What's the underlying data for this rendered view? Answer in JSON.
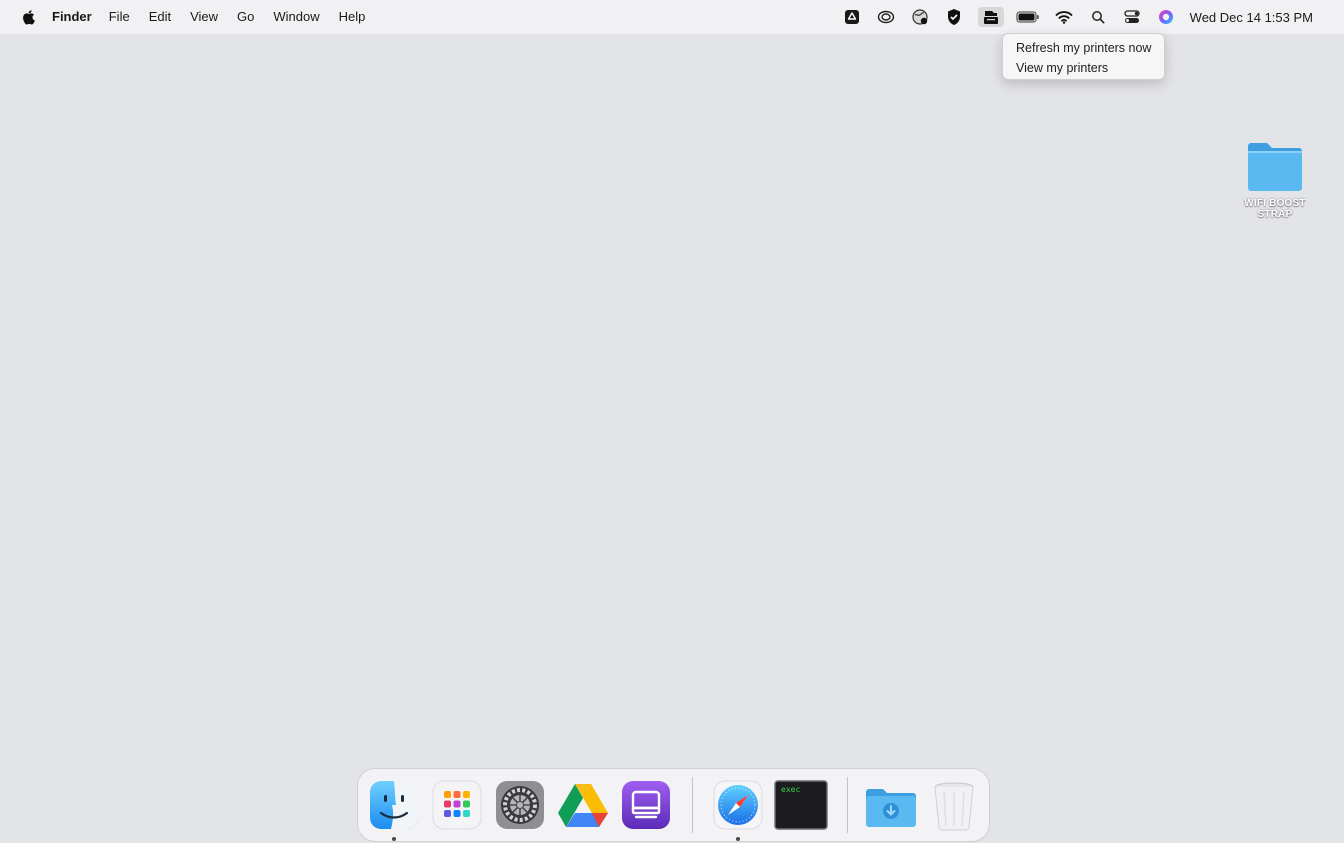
{
  "menubar": {
    "app_name": "Finder",
    "menus": [
      "File",
      "Edit",
      "View",
      "Go",
      "Window",
      "Help"
    ],
    "clock": "Wed Dec 14  1:53 PM",
    "status_icons": [
      "google-drive-icon",
      "creative-cloud-icon",
      "vpn-globe-icon",
      "shield-icon",
      "printer-tray-icon",
      "battery-icon",
      "wifi-icon",
      "spotlight-search-icon",
      "control-center-icon",
      "siri-icon"
    ]
  },
  "printer_menu": {
    "items": [
      "Refresh my printers now",
      "View my printers"
    ]
  },
  "desktop": {
    "folder_label_line1": "WIFI BOOST",
    "folder_label_line2": "STRAP"
  },
  "dock": {
    "apps": [
      "finder-icon",
      "launchpad-icon",
      "system-preferences-icon",
      "google-drive-icon",
      "printer-app-icon",
      "safari-icon",
      "terminal-icon",
      "downloads-folder-icon",
      "trash-icon"
    ],
    "terminal_text": "exec"
  },
  "colors": {
    "desktop_bg": "#e3e4e8",
    "menubar_bg": "#f1f1f3",
    "folder_blue": "#5ab9f0"
  }
}
